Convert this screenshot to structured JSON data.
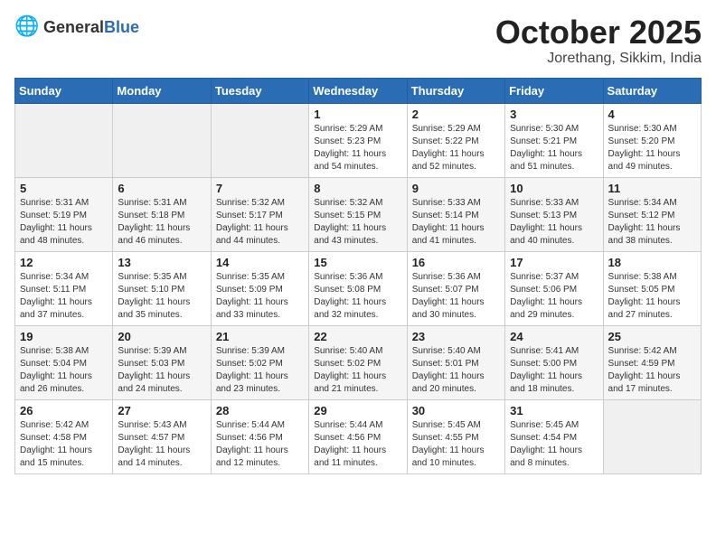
{
  "header": {
    "logo_general": "General",
    "logo_blue": "Blue",
    "month": "October 2025",
    "location": "Jorethang, Sikkim, India"
  },
  "days_of_week": [
    "Sunday",
    "Monday",
    "Tuesday",
    "Wednesday",
    "Thursday",
    "Friday",
    "Saturday"
  ],
  "weeks": [
    [
      {
        "day": "",
        "info": ""
      },
      {
        "day": "",
        "info": ""
      },
      {
        "day": "",
        "info": ""
      },
      {
        "day": "1",
        "info": "Sunrise: 5:29 AM\nSunset: 5:23 PM\nDaylight: 11 hours\nand 54 minutes."
      },
      {
        "day": "2",
        "info": "Sunrise: 5:29 AM\nSunset: 5:22 PM\nDaylight: 11 hours\nand 52 minutes."
      },
      {
        "day": "3",
        "info": "Sunrise: 5:30 AM\nSunset: 5:21 PM\nDaylight: 11 hours\nand 51 minutes."
      },
      {
        "day": "4",
        "info": "Sunrise: 5:30 AM\nSunset: 5:20 PM\nDaylight: 11 hours\nand 49 minutes."
      }
    ],
    [
      {
        "day": "5",
        "info": "Sunrise: 5:31 AM\nSunset: 5:19 PM\nDaylight: 11 hours\nand 48 minutes."
      },
      {
        "day": "6",
        "info": "Sunrise: 5:31 AM\nSunset: 5:18 PM\nDaylight: 11 hours\nand 46 minutes."
      },
      {
        "day": "7",
        "info": "Sunrise: 5:32 AM\nSunset: 5:17 PM\nDaylight: 11 hours\nand 44 minutes."
      },
      {
        "day": "8",
        "info": "Sunrise: 5:32 AM\nSunset: 5:15 PM\nDaylight: 11 hours\nand 43 minutes."
      },
      {
        "day": "9",
        "info": "Sunrise: 5:33 AM\nSunset: 5:14 PM\nDaylight: 11 hours\nand 41 minutes."
      },
      {
        "day": "10",
        "info": "Sunrise: 5:33 AM\nSunset: 5:13 PM\nDaylight: 11 hours\nand 40 minutes."
      },
      {
        "day": "11",
        "info": "Sunrise: 5:34 AM\nSunset: 5:12 PM\nDaylight: 11 hours\nand 38 minutes."
      }
    ],
    [
      {
        "day": "12",
        "info": "Sunrise: 5:34 AM\nSunset: 5:11 PM\nDaylight: 11 hours\nand 37 minutes."
      },
      {
        "day": "13",
        "info": "Sunrise: 5:35 AM\nSunset: 5:10 PM\nDaylight: 11 hours\nand 35 minutes."
      },
      {
        "day": "14",
        "info": "Sunrise: 5:35 AM\nSunset: 5:09 PM\nDaylight: 11 hours\nand 33 minutes."
      },
      {
        "day": "15",
        "info": "Sunrise: 5:36 AM\nSunset: 5:08 PM\nDaylight: 11 hours\nand 32 minutes."
      },
      {
        "day": "16",
        "info": "Sunrise: 5:36 AM\nSunset: 5:07 PM\nDaylight: 11 hours\nand 30 minutes."
      },
      {
        "day": "17",
        "info": "Sunrise: 5:37 AM\nSunset: 5:06 PM\nDaylight: 11 hours\nand 29 minutes."
      },
      {
        "day": "18",
        "info": "Sunrise: 5:38 AM\nSunset: 5:05 PM\nDaylight: 11 hours\nand 27 minutes."
      }
    ],
    [
      {
        "day": "19",
        "info": "Sunrise: 5:38 AM\nSunset: 5:04 PM\nDaylight: 11 hours\nand 26 minutes."
      },
      {
        "day": "20",
        "info": "Sunrise: 5:39 AM\nSunset: 5:03 PM\nDaylight: 11 hours\nand 24 minutes."
      },
      {
        "day": "21",
        "info": "Sunrise: 5:39 AM\nSunset: 5:02 PM\nDaylight: 11 hours\nand 23 minutes."
      },
      {
        "day": "22",
        "info": "Sunrise: 5:40 AM\nSunset: 5:02 PM\nDaylight: 11 hours\nand 21 minutes."
      },
      {
        "day": "23",
        "info": "Sunrise: 5:40 AM\nSunset: 5:01 PM\nDaylight: 11 hours\nand 20 minutes."
      },
      {
        "day": "24",
        "info": "Sunrise: 5:41 AM\nSunset: 5:00 PM\nDaylight: 11 hours\nand 18 minutes."
      },
      {
        "day": "25",
        "info": "Sunrise: 5:42 AM\nSunset: 4:59 PM\nDaylight: 11 hours\nand 17 minutes."
      }
    ],
    [
      {
        "day": "26",
        "info": "Sunrise: 5:42 AM\nSunset: 4:58 PM\nDaylight: 11 hours\nand 15 minutes."
      },
      {
        "day": "27",
        "info": "Sunrise: 5:43 AM\nSunset: 4:57 PM\nDaylight: 11 hours\nand 14 minutes."
      },
      {
        "day": "28",
        "info": "Sunrise: 5:44 AM\nSunset: 4:56 PM\nDaylight: 11 hours\nand 12 minutes."
      },
      {
        "day": "29",
        "info": "Sunrise: 5:44 AM\nSunset: 4:56 PM\nDaylight: 11 hours\nand 11 minutes."
      },
      {
        "day": "30",
        "info": "Sunrise: 5:45 AM\nSunset: 4:55 PM\nDaylight: 11 hours\nand 10 minutes."
      },
      {
        "day": "31",
        "info": "Sunrise: 5:45 AM\nSunset: 4:54 PM\nDaylight: 11 hours\nand 8 minutes."
      },
      {
        "day": "",
        "info": ""
      }
    ]
  ]
}
